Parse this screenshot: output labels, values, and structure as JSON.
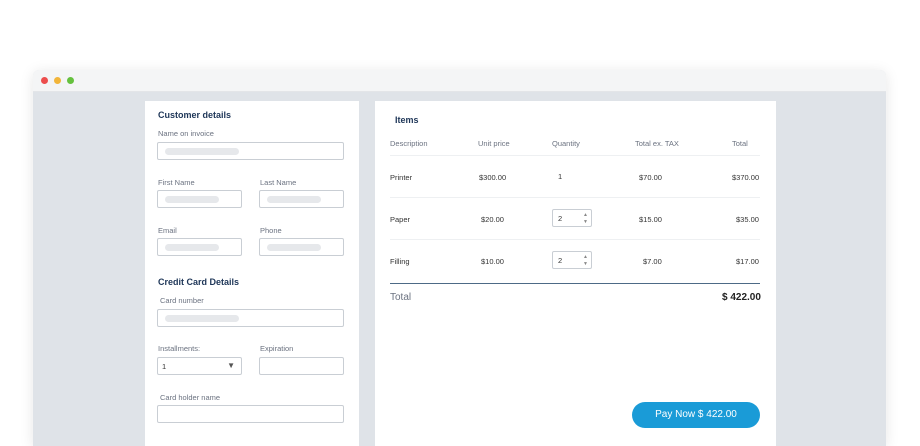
{
  "window": {
    "traffic_lights": [
      "close",
      "minimize",
      "maximize"
    ],
    "colors": {
      "red": "#ec4d4d",
      "yellow": "#f2b53a",
      "green": "#65c13e"
    }
  },
  "customer": {
    "title": "Customer details",
    "name_on_invoice_label": "Name on invoice",
    "first_name_label": "First Name",
    "last_name_label": "Last Name",
    "email_label": "Email",
    "phone_label": "Phone"
  },
  "card": {
    "title": "Credit Card Details",
    "card_number_label": "Card number",
    "installments_label": "Installments:",
    "installments_value": "1",
    "expiration_label": "Expiration",
    "holder_label": "Card holder name"
  },
  "items": {
    "title": "Items",
    "columns": [
      "Description",
      "Unit price",
      "Quantity",
      "Total ex. TAX",
      "Total"
    ],
    "rows": [
      {
        "description": "Printer",
        "unit_price": "$300.00",
        "quantity": "1",
        "total_ex_tax": "$70.00",
        "total": "$370.00",
        "editable": false
      },
      {
        "description": "Paper",
        "unit_price": "$20.00",
        "quantity": "2",
        "total_ex_tax": "$15.00",
        "total": "$35.00",
        "editable": true
      },
      {
        "description": "Filling",
        "unit_price": "$10.00",
        "quantity": "2",
        "total_ex_tax": "$7.00",
        "total": "$17.00",
        "editable": true
      }
    ],
    "total_label": "Total",
    "total_value": "$ 422.00",
    "pay_button": "Pay Now $ 422.00"
  },
  "colors": {
    "accent": "#1a9bd7",
    "heading": "#1d3557"
  }
}
